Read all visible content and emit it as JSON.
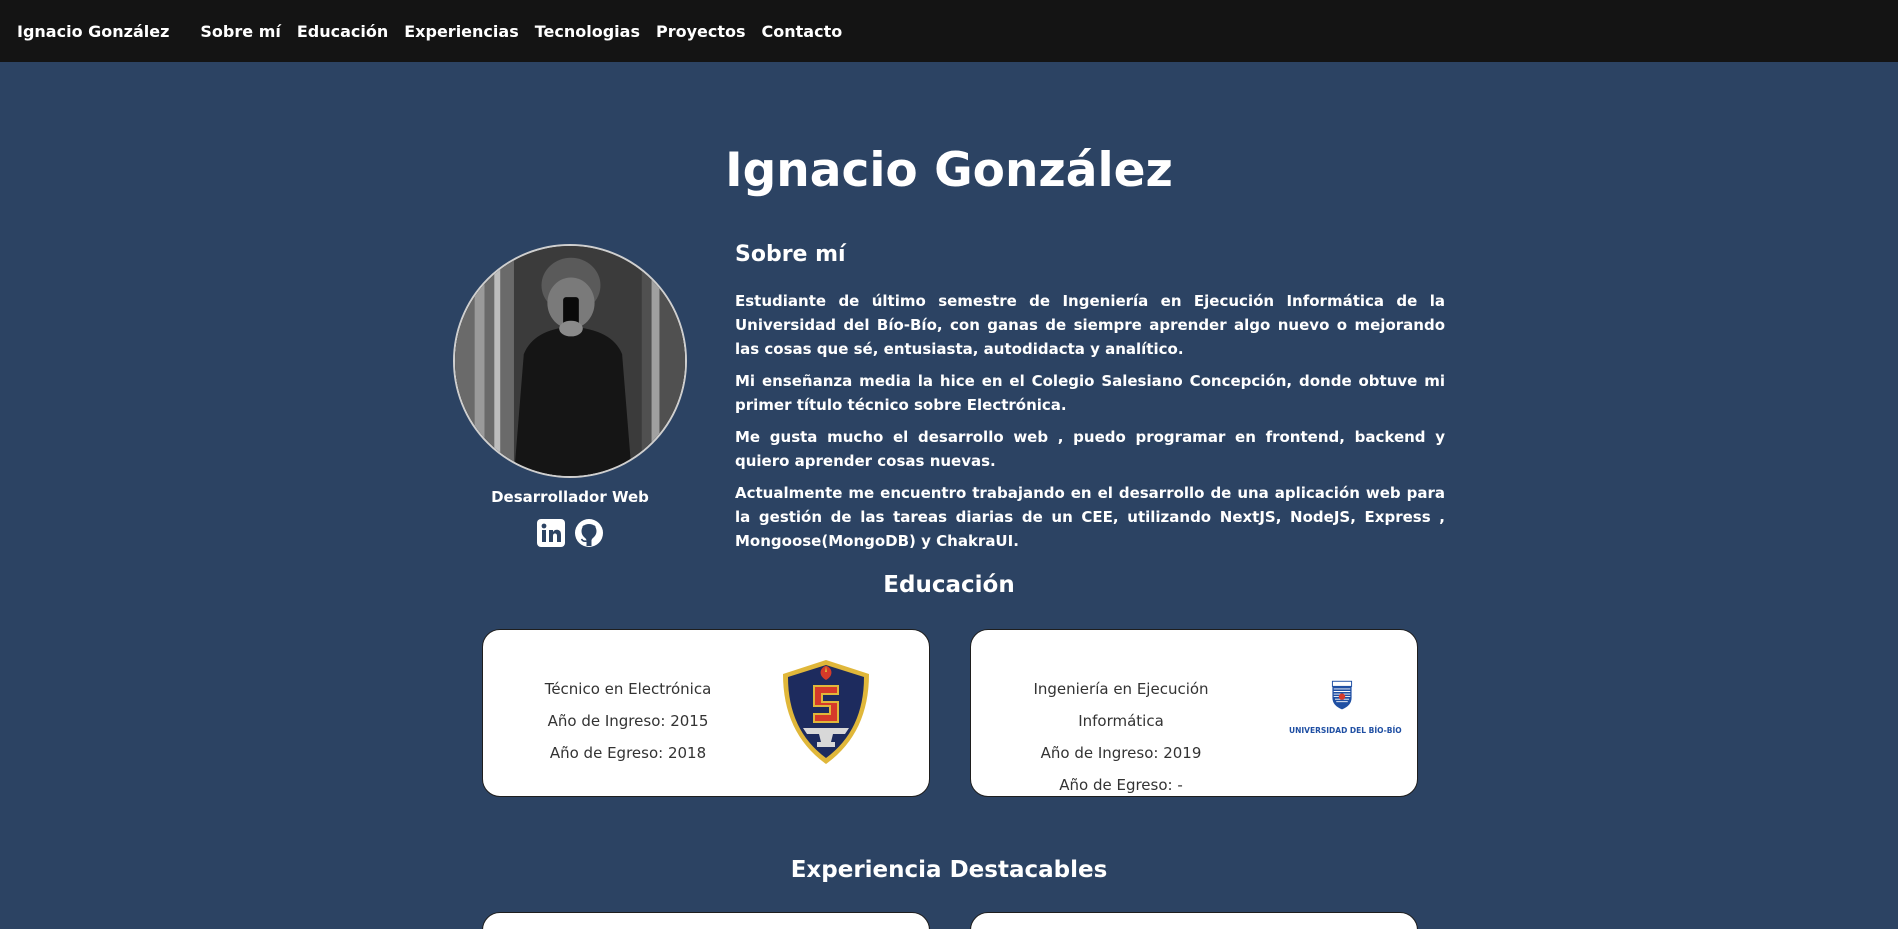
{
  "nav": {
    "brand": "Ignacio González",
    "links": [
      "Sobre mí",
      "Educación",
      "Experiencias",
      "Tecnologias",
      "Proyectos",
      "Contacto"
    ]
  },
  "hero": {
    "title": "Ignacio González",
    "role": "Desarrollador Web",
    "avatar_icon": "profile-photo",
    "socials": [
      {
        "name": "linkedin-icon"
      },
      {
        "name": "github-icon"
      }
    ]
  },
  "about": {
    "title": "Sobre mí",
    "paragraphs": [
      "Estudiante de último semestre de Ingeniería en Ejecución Informática de la Universidad del Bío-Bío, con ganas de siempre aprender algo nuevo o mejorando las cosas que sé, entusiasta, autodidacta y analítico.",
      "Mi enseñanza media la hice en el Colegio Salesiano Concepción, donde obtuve mi primer título técnico sobre Electrónica.",
      "Me gusta mucho el desarrollo web , puedo programar en frontend, backend y quiero aprender cosas nuevas.",
      "Actualmente me encuentro trabajando en el desarrollo de una aplicación web para la gestión de las tareas diarias de un CEE, utilizando NextJS, NodeJS, Express , Mongoose(MongoDB) y ChakraUI."
    ]
  },
  "education": {
    "title": "Educación",
    "items": [
      {
        "degree": "Técnico en Electrónica",
        "ingreso": "Año de Ingreso: 2015",
        "egreso": "Año de Egreso: 2018",
        "logo_icon": "salesiano-shield-logo"
      },
      {
        "degree": "Ingeniería en Ejecución Informática",
        "ingreso": "Año de Ingreso: 2019",
        "egreso": "Año de Egreso: -",
        "logo_icon": "ubb-logo",
        "logo_text": "UNIVERSIDAD DEL BÍO-BÍO"
      }
    ]
  },
  "experience": {
    "title": "Experiencia Destacables"
  },
  "colors": {
    "background": "#2c4363",
    "navbar": "#141414",
    "card": "#ffffff",
    "ubb_blue": "#1f4fa3",
    "shield_navy": "#1d2b5e",
    "shield_gold": "#e0b73a",
    "shield_red": "#d63a2a"
  }
}
